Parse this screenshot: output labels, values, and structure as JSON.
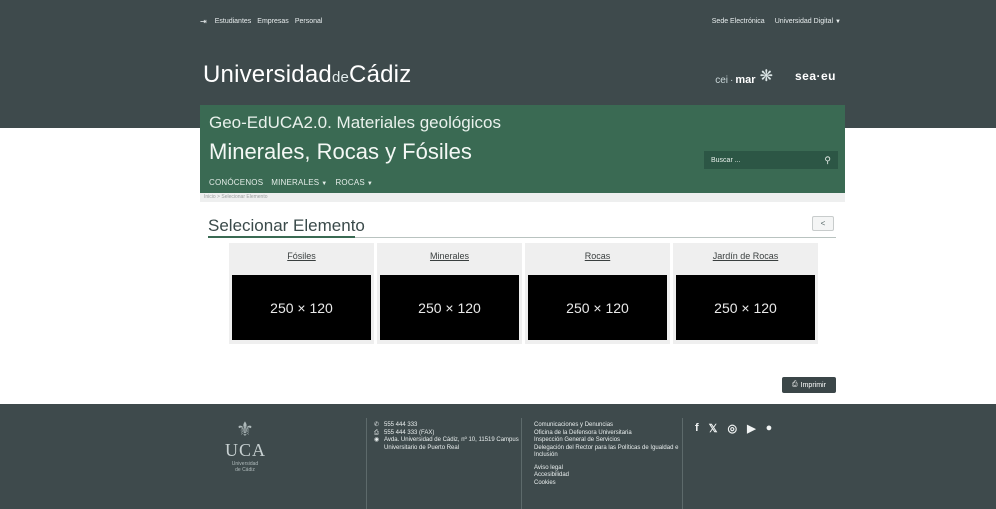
{
  "topbar": {
    "links": [
      "Estudiantes",
      "Empresas",
      "Personal"
    ],
    "right_links": [
      "Sede Electrónica",
      "Universidad Digital"
    ]
  },
  "brand": {
    "part1": "Universidad",
    "part2": "de",
    "part3": "Cádiz"
  },
  "logos": {
    "ceimar_prefix": "cei",
    "ceimar_main": "mar",
    "seaeu": "sea·eu"
  },
  "hero": {
    "subtitle": "Geo-EdUCA2.0. Materiales geológicos",
    "title": "Minerales, Rocas y Fósiles",
    "search_placeholder": "Buscar ...",
    "nav": [
      "CONÓCENOS",
      "MINERALES",
      "ROCAS"
    ]
  },
  "breadcrumb": "Inicio > Selecionar Elemento",
  "main": {
    "section_title": "Selecionar Elemento",
    "cards": [
      {
        "label": "Fósiles",
        "thumb": "250 × 120"
      },
      {
        "label": "Minerales",
        "thumb": "250 × 120"
      },
      {
        "label": "Rocas",
        "thumb": "250 × 120"
      },
      {
        "label": "Jardín de Rocas",
        "thumb": "250 × 120"
      }
    ],
    "print_label": "Imprimir"
  },
  "footer": {
    "uca_word": "UCA",
    "uca_sub1": "Universidad",
    "uca_sub2": "de Cádiz",
    "phone": "555 444 333",
    "fax": "555 444 333 (FAX)",
    "address": "Avda. Universidad de Cádiz, nº 10, 11519 Campus Universitario de Puerto Real",
    "links1": [
      "Comunicaciones y Denuncias",
      "Oficina de la Defensora Universitaria",
      "Inspección General de Servicios",
      "Delegación del Rector para las Políticas de Igualdad e Inclusión"
    ],
    "links2": [
      "Aviso legal",
      "Accesibilidad",
      "Cookies"
    ],
    "social_icons": [
      "facebook-icon",
      "x-icon",
      "instagram-icon",
      "youtube-icon",
      "flickr-icon"
    ]
  },
  "colors": {
    "header_bg": "#3e4a4c",
    "hero_green": "#3a6a53"
  }
}
